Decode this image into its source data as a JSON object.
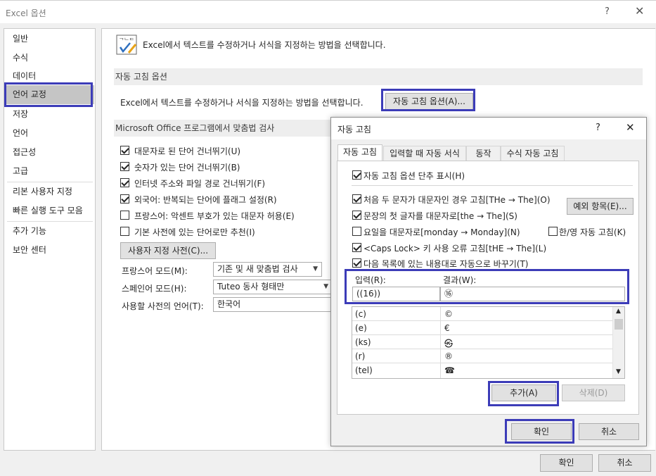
{
  "window": {
    "title": "Excel 옵션",
    "help_glyph": "?",
    "close_glyph": "✕"
  },
  "sidebar": {
    "items": [
      {
        "label": "일반"
      },
      {
        "label": "수식"
      },
      {
        "label": "데이터"
      },
      {
        "label": "언어 교정",
        "selected": true
      },
      {
        "label": "저장"
      },
      {
        "label": "언어"
      },
      {
        "label": "접근성"
      },
      {
        "label": "고급"
      },
      {
        "label": "리본 사용자 지정"
      },
      {
        "label": "빠른 실행 도구 모음"
      },
      {
        "label": "추가 기능"
      },
      {
        "label": "보안 센터"
      }
    ]
  },
  "main": {
    "heading": "Excel에서 텍스트를 수정하거나 서식을 지정하는 방법을 선택합니다.",
    "autocorrect_section": {
      "header": "자동 고침 옵션",
      "description": "Excel에서 텍스트를 수정하거나 서식을 지정하는 방법을 선택합니다.",
      "button": "자동 고침 옵션(A)..."
    },
    "spelling_section": {
      "header": "Microsoft Office 프로그램에서 맞춤법 검사",
      "options": [
        {
          "label": "대문자로 된 단어 건너뛰기(U)",
          "checked": true
        },
        {
          "label": "숫자가 있는 단어 건너뛰기(B)",
          "checked": true
        },
        {
          "label": "인터넷 주소와 파일 경로 건너뛰기(F)",
          "checked": true
        },
        {
          "label": "외국어: 반복되는 단어에 플래그 설정(R)",
          "checked": true
        },
        {
          "label": "프랑스어: 악센트 부호가 있는 대문자 허용(E)",
          "checked": false
        },
        {
          "label": "기본 사전에 있는 단어로만 추천(I)",
          "checked": false
        }
      ],
      "custom_dict_button": "사용자 지정 사전(C)...",
      "french_mode_label": "프랑스어 모드(M):",
      "french_mode_value": "기존 및 새 맞춤법 검사",
      "spanish_mode_label": "스페인어 모드(H):",
      "spanish_mode_value": "Tuteo 동사 형태만",
      "dict_language_label": "사용할 사전의 언어(T):",
      "dict_language_value": "한국어"
    },
    "ok_button": "확인",
    "cancel_button": "취소"
  },
  "dialog": {
    "title": "자동 고침",
    "help_glyph": "?",
    "close_glyph": "✕",
    "tabs": [
      {
        "label": "자동 고침",
        "active": true
      },
      {
        "label": "입력할 때 자동 서식"
      },
      {
        "label": "동작"
      },
      {
        "label": "수식 자동 고침"
      }
    ],
    "show_buttons_label": "자동 고침 옵션 단추 표시(H)",
    "options": {
      "two_initial_caps": "처음 두 문자가 대문자인 경우 고침[THe → The](O)",
      "capitalize_sentence": "문장의 첫 글자를 대문자로[the → The](S)",
      "capitalize_days": "요일을 대문자로[monday → Monday](N)",
      "caps_lock": "<Caps Lock> 키 사용 오류 고침[tHE → The](L)",
      "replace_text": "다음 목록에 있는 내용대로 자동으로 바꾸기(T)",
      "hangul_english": "한/영 자동 고침(K)"
    },
    "exceptions_button": "예외 항목(E)...",
    "replace_label": "입력(R):",
    "with_label": "결과(W):",
    "replace_value": "((16))",
    "with_value": "⑯",
    "entries": [
      {
        "replace": "(c)",
        "with": "©"
      },
      {
        "replace": "(e)",
        "with": "€"
      },
      {
        "replace": "(ks)",
        "with": "㉿"
      },
      {
        "replace": "(r)",
        "with": "®"
      },
      {
        "replace": "(tel)",
        "with": "☎"
      }
    ],
    "add_button": "추가(A)",
    "delete_button": "삭제(D)",
    "ok_button": "확인",
    "cancel_button": "취소"
  },
  "colors": {
    "highlight": "#3c3cb8",
    "selected_item": "#c5c5c5"
  }
}
